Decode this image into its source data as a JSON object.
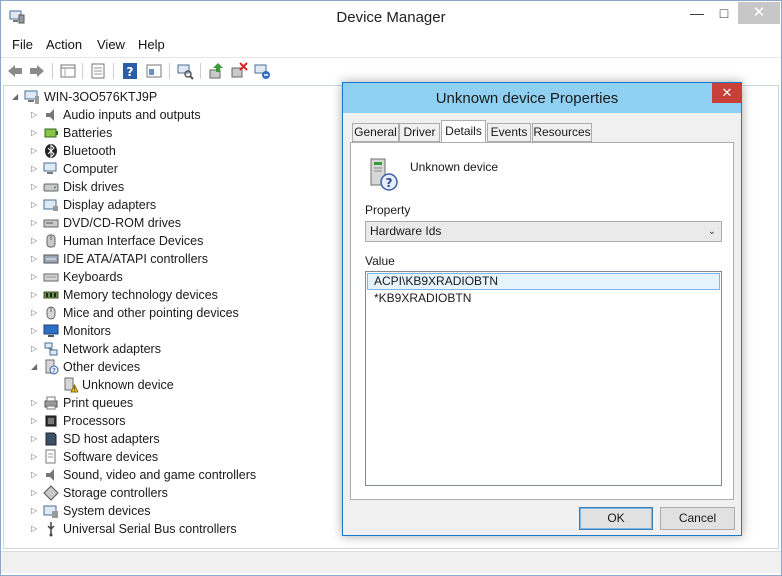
{
  "window": {
    "title": "Device Manager"
  },
  "menu": [
    "File",
    "Action",
    "View",
    "Help"
  ],
  "toolbar_icons": [
    "back-arrow-icon",
    "forward-arrow-icon",
    "properties-grid-icon",
    "show-hide-tree-icon",
    "help-icon",
    "view-resources-icon",
    "scan-hardware-icon",
    "update-driver-icon",
    "disable-device-icon",
    "uninstall-device-icon"
  ],
  "tree": {
    "root": "WIN-3OO576KTJ9P",
    "categories": [
      {
        "label": "Audio inputs and outputs",
        "icon": "speaker-icon",
        "expanded": false
      },
      {
        "label": "Batteries",
        "icon": "battery-icon",
        "expanded": false
      },
      {
        "label": "Bluetooth",
        "icon": "bluetooth-icon",
        "expanded": false
      },
      {
        "label": "Computer",
        "icon": "computer-icon",
        "expanded": false
      },
      {
        "label": "Disk drives",
        "icon": "disk-drive-icon",
        "expanded": false
      },
      {
        "label": "Display adapters",
        "icon": "display-adapter-icon",
        "expanded": false
      },
      {
        "label": "DVD/CD-ROM drives",
        "icon": "dvd-drive-icon",
        "expanded": false
      },
      {
        "label": "Human Interface Devices",
        "icon": "hid-icon",
        "expanded": false
      },
      {
        "label": "IDE ATA/ATAPI controllers",
        "icon": "ide-controller-icon",
        "expanded": false
      },
      {
        "label": "Keyboards",
        "icon": "keyboard-icon",
        "expanded": false
      },
      {
        "label": "Memory technology devices",
        "icon": "memory-icon",
        "expanded": false
      },
      {
        "label": "Mice and other pointing devices",
        "icon": "mouse-icon",
        "expanded": false
      },
      {
        "label": "Monitors",
        "icon": "monitor-icon",
        "expanded": false
      },
      {
        "label": "Network adapters",
        "icon": "network-icon",
        "expanded": false
      },
      {
        "label": "Other devices",
        "icon": "other-devices-icon",
        "expanded": true
      },
      {
        "label": "Unknown device",
        "icon": "unknown-device-warning-icon",
        "child": true
      },
      {
        "label": "Print queues",
        "icon": "printer-icon",
        "expanded": false
      },
      {
        "label": "Processors",
        "icon": "processor-icon",
        "expanded": false
      },
      {
        "label": "SD host adapters",
        "icon": "sd-adapter-icon",
        "expanded": false
      },
      {
        "label": "Software devices",
        "icon": "software-device-icon",
        "expanded": false
      },
      {
        "label": "Sound, video and game controllers",
        "icon": "sound-icon",
        "expanded": false
      },
      {
        "label": "Storage controllers",
        "icon": "storage-controller-icon",
        "expanded": false
      },
      {
        "label": "System devices",
        "icon": "system-device-icon",
        "expanded": false
      },
      {
        "label": "Universal Serial Bus controllers",
        "icon": "usb-icon",
        "expanded": false
      }
    ]
  },
  "dialog": {
    "title": "Unknown device Properties",
    "close": "✕",
    "tabs": [
      "General",
      "Driver",
      "Details",
      "Events",
      "Resources"
    ],
    "active_tab": "Details",
    "device_name": "Unknown device",
    "property_label": "Property",
    "property_value": "Hardware Ids",
    "value_label": "Value",
    "values": [
      "ACPI\\KB9XRADIOBTN",
      "*KB9XRADIOBTN"
    ],
    "ok": "OK",
    "cancel": "Cancel"
  },
  "colors": {
    "dialog_title": "#8fd0f3",
    "dialog_border": "#1979ca",
    "close_red": "#c7403a",
    "selection": "#e5f3fb"
  }
}
